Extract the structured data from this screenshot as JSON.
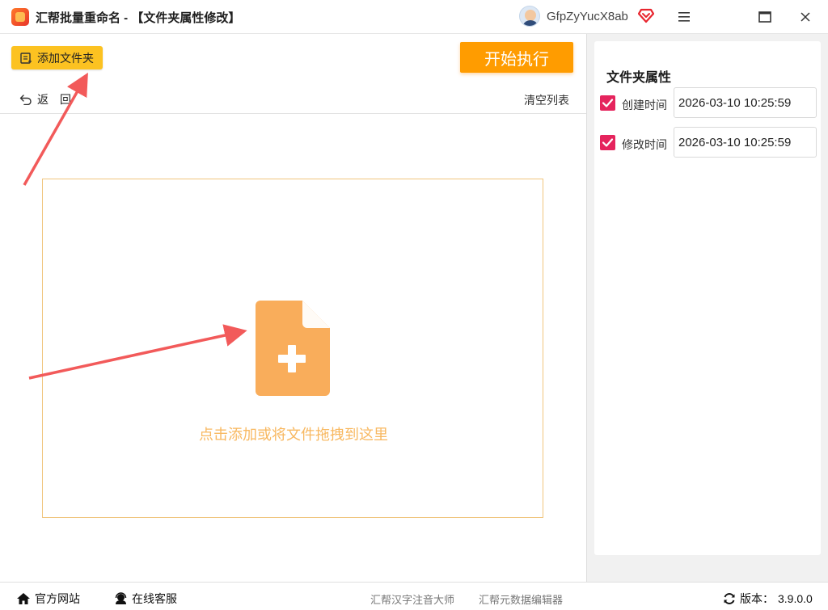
{
  "app": {
    "title": "汇帮批量重命名 - 【文件夹属性修改】",
    "username": "GfpZyYucX8ab"
  },
  "toolbar": {
    "add_folder_label": "添加文件夹",
    "start_label": "开始执行",
    "back_label": "返回",
    "clear_list_label": "清空列表"
  },
  "drop_zone": {
    "hint": "点击添加或将文件拖拽到这里"
  },
  "panel": {
    "title": "文件夹属性",
    "fields": [
      {
        "label": "创建时间",
        "value": "2026-03-10 10:25:59",
        "checked": true
      },
      {
        "label": "修改时间",
        "value": "2026-03-10 10:25:59",
        "checked": true
      }
    ]
  },
  "footer": {
    "website_label": "官方网站",
    "service_label": "在线客服",
    "hanzi_label": "汇帮汉字注音大师",
    "metadata_label": "汇帮元数据编辑器",
    "version_label": "版本：",
    "version": "3.9.0.0"
  },
  "colors": {
    "accent_yellow": "#fcc221",
    "start_orange": "#ff9c00",
    "drop_border": "#f0c57e",
    "drop_hint": "#f8b860",
    "checkbox": "#e5245d",
    "annotation_arrow": "#f25a5a"
  },
  "icons": [
    "app-logo-icon",
    "user-avatar",
    "vip-diamond-icon",
    "menu-icon",
    "maximize-icon",
    "close-icon",
    "add-folder-icon",
    "back-arrow-icon",
    "file-add-icon",
    "home-icon",
    "headset-icon",
    "refresh-icon"
  ]
}
